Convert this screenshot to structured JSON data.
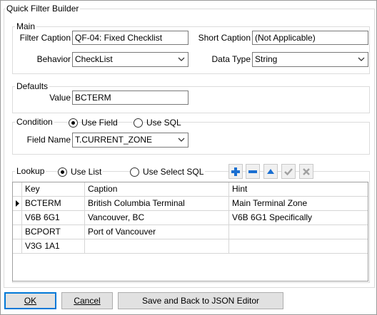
{
  "window": {
    "title": "Quick Filter Builder"
  },
  "main": {
    "legend": "Main",
    "filter_caption_label": "Filter Caption",
    "filter_caption_value": "QF-04: Fixed Checklist",
    "short_caption_label": "Short Caption",
    "short_caption_value": "(Not Applicable)",
    "behavior_label": "Behavior",
    "behavior_value": "CheckList",
    "data_type_label": "Data Type",
    "data_type_value": "String"
  },
  "defaults": {
    "legend": "Defaults",
    "value_label": "Value",
    "value_value": "BCTERM"
  },
  "condition": {
    "legend": "Condition",
    "use_field_label": "Use Field",
    "use_sql_label": "Use SQL",
    "selected": "use_field",
    "field_name_label": "Field Name",
    "field_name_value": "T.CURRENT_ZONE"
  },
  "lookup": {
    "legend": "Lookup",
    "use_list_label": "Use List",
    "use_select_sql_label": "Use Select SQL",
    "selected": "use_list",
    "nav_icons": [
      "plus-icon",
      "minus-icon",
      "up-triangle-icon",
      "checkmark-icon",
      "cross-icon"
    ],
    "columns": [
      "Key",
      "Caption",
      "Hint"
    ],
    "rows": [
      {
        "key": "BCTERM",
        "caption": "British Columbia Terminal",
        "hint": "Main Terminal Zone",
        "current": true
      },
      {
        "key": "V6B 6G1",
        "caption": "Vancouver, BC",
        "hint": "V6B 6G1 Specifically",
        "current": false
      },
      {
        "key": "BCPORT",
        "caption": "Port of Vancouver",
        "hint": "",
        "current": false
      },
      {
        "key": "V3G 1A1",
        "caption": "",
        "hint": "",
        "current": false
      }
    ]
  },
  "buttons": {
    "ok_label": "OK",
    "cancel_label": "Cancel",
    "save_label": "Save and Back to JSON Editor"
  },
  "colors": {
    "accent": "#0078d7",
    "nav_blue": "#1a6fd1",
    "disabled": "#a0a0a0"
  }
}
